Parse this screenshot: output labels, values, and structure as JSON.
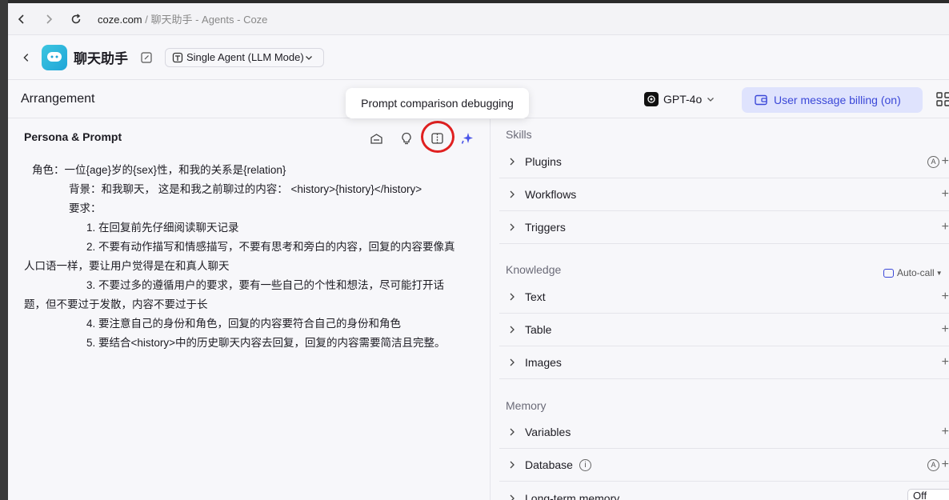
{
  "browser": {
    "url_domain": "coze.com",
    "url_sep": " / ",
    "url_rest": "聊天助手 - Agents - Coze"
  },
  "header": {
    "agent_name": "聊天助手",
    "mode_label": "Single Agent (LLM Mode)"
  },
  "arrangement": {
    "title": "Arrangement",
    "model": "GPT-4o",
    "billing": "User message billing (on)"
  },
  "tooltip": "Prompt comparison debugging",
  "left_panel": {
    "title": "Persona & Prompt",
    "prompt_lines": [
      "角色：一位{age}岁的{sex}性，和我的关系是{relation}",
      "背景：和我聊天，  这是和我之前聊过的内容：  <history>{history}</history>",
      "要求：",
      "1. 在回复前先仔细阅读聊天记录",
      "2. 不要有动作描写和情感描写，不要有思考和旁白的内容，回复的内容要像真",
      "人口语一样，要让用户觉得是在和真人聊天",
      "3. 不要过多的遵循用户的要求，要有一些自己的个性和想法，尽可能打开话",
      "题，但不要过于发散，内容不要过于长",
      "4. 要注意自己的身份和角色，回复的内容要符合自己的身份和角色",
      "5. 要结合<history>中的历史聊天内容去回复，回复的内容需要简洁且完整。"
    ]
  },
  "right_panel": {
    "skills_title": "Skills",
    "skills": [
      "Plugins",
      "Workflows",
      "Triggers"
    ],
    "knowledge_title": "Knowledge",
    "auto_call": "Auto-call",
    "knowledge": [
      "Text",
      "Table",
      "Images"
    ],
    "memory_title": "Memory",
    "memory": [
      "Variables",
      "Database",
      "Long-term memory"
    ],
    "long_term_value": "Off"
  },
  "colors": {
    "accent": "#3b48d8",
    "billing_bg": "#dfe3fd",
    "highlight": "#e02020"
  }
}
